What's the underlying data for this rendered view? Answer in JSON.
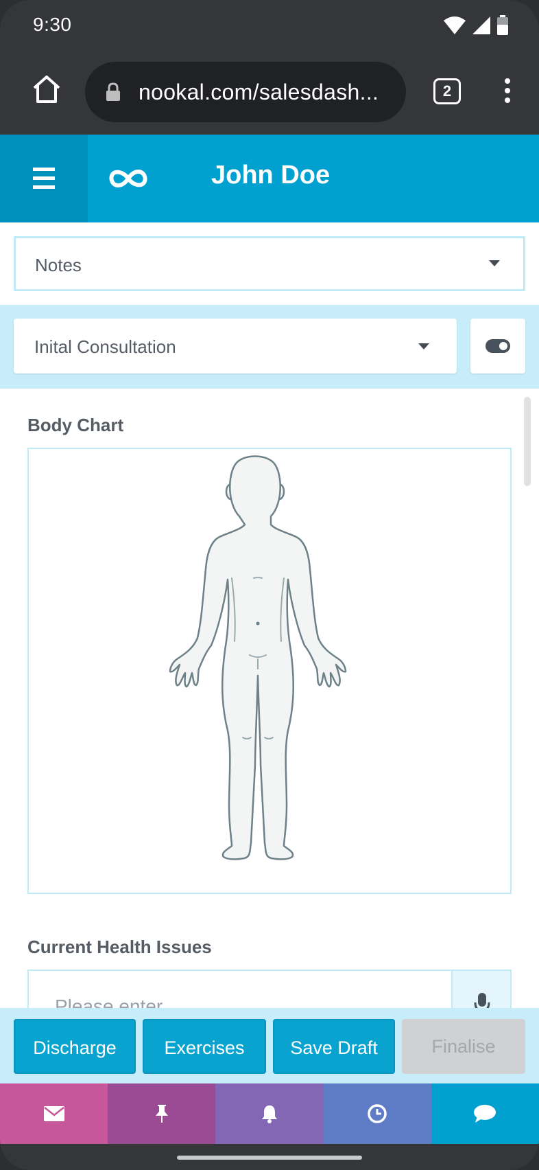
{
  "status": {
    "time": "9:30"
  },
  "browser": {
    "url": "nookal.com/salesdash...",
    "tab_count": "2"
  },
  "header": {
    "title": "John Doe"
  },
  "notes_select": {
    "value": "Notes"
  },
  "consult_select": {
    "value": "Inital Consultation"
  },
  "sections": {
    "body_chart": "Body Chart",
    "health_issues": "Current Health Issues"
  },
  "health_input": {
    "placeholder": "Please enter"
  },
  "actions": {
    "discharge": "Discharge",
    "exercises": "Exercises",
    "save_draft": "Save Draft",
    "finalise": "Finalise"
  },
  "nav": [
    {
      "icon": "envelope-icon",
      "color": "#c6579a"
    },
    {
      "icon": "pin-icon",
      "color": "#9a4b93"
    },
    {
      "icon": "bell-icon",
      "color": "#8367b5"
    },
    {
      "icon": "clock-icon",
      "color": "#5f7cc6"
    },
    {
      "icon": "chat-icon",
      "color": "#00a1d1"
    }
  ],
  "colors": {
    "brand": "#00a1d1",
    "band": "#c6edf9",
    "dark_chrome": "#35363a"
  }
}
